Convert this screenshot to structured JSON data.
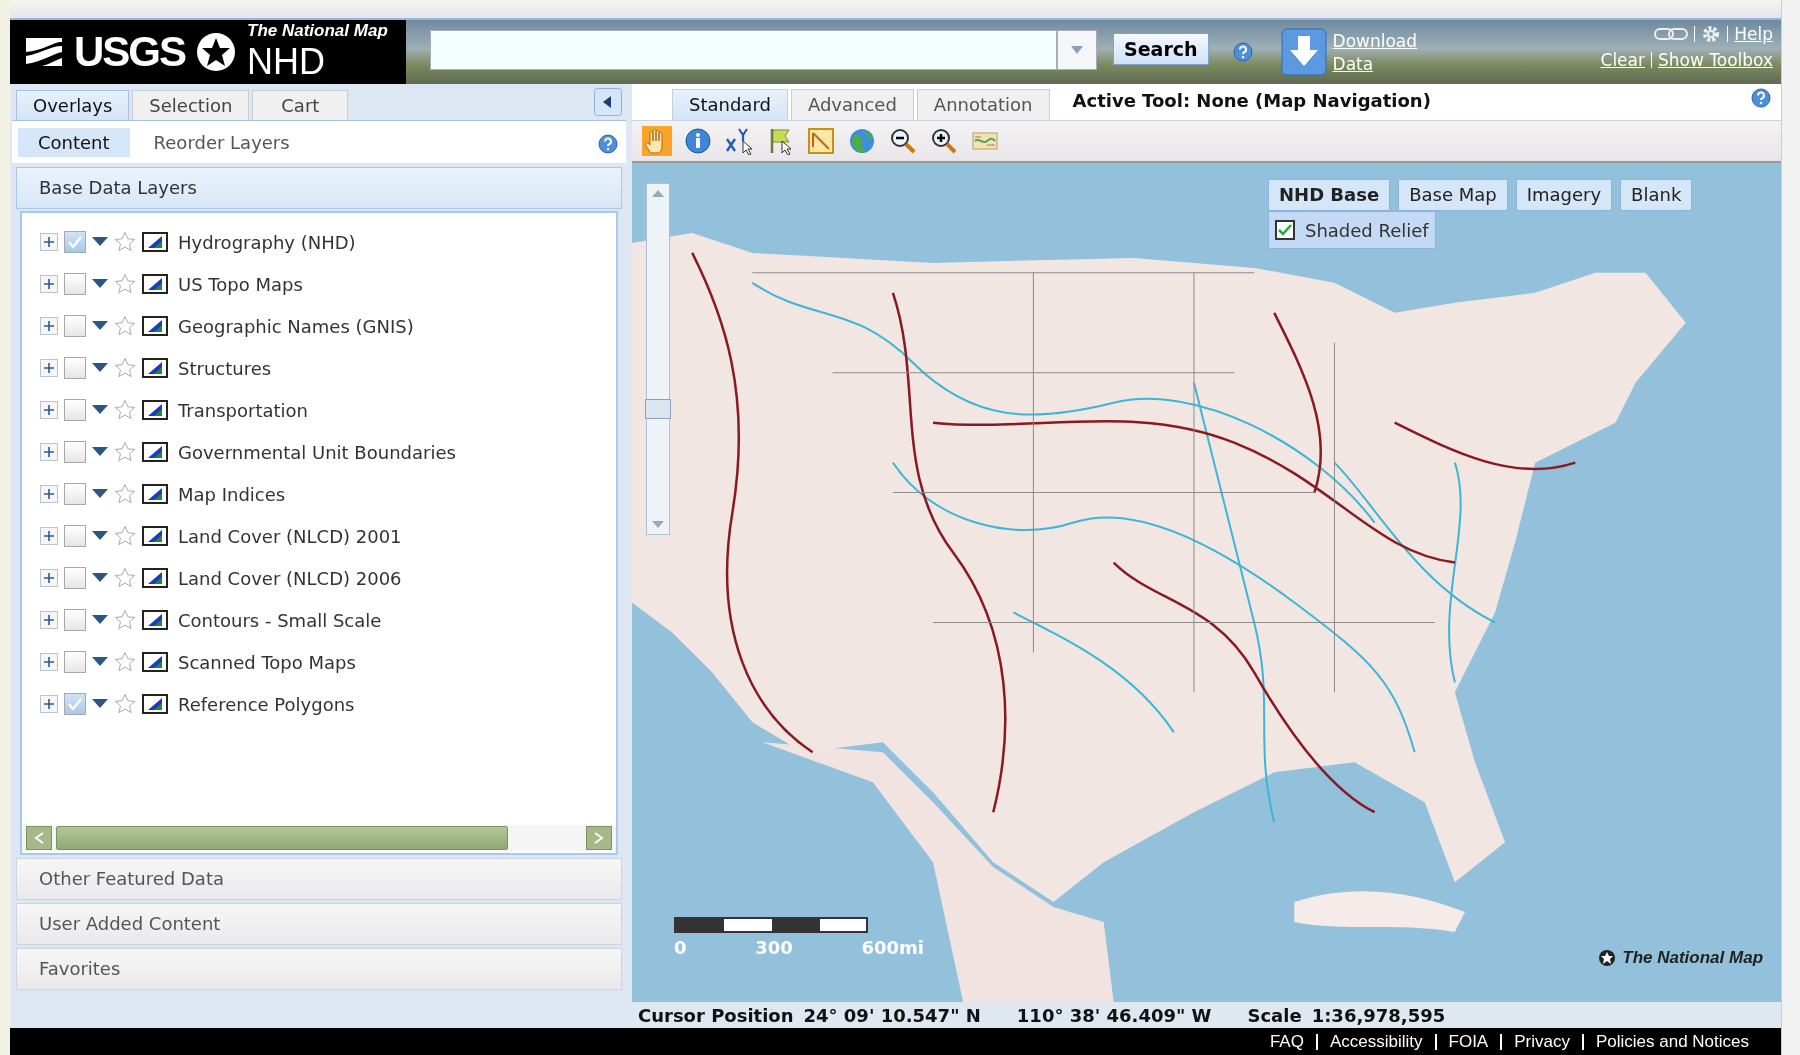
{
  "header": {
    "agency": "USGS",
    "product_title": "The National Map",
    "product_name": "NHD",
    "search_button": "Search",
    "download_link": "Download Data",
    "top_links": [
      "Help"
    ],
    "tool_links": [
      "Clear",
      "Show Toolbox"
    ]
  },
  "left_panel": {
    "tabs": [
      {
        "label": "Overlays",
        "selected": true
      },
      {
        "label": "Selection",
        "selected": false
      },
      {
        "label": "Cart",
        "selected": false
      }
    ],
    "subtabs": [
      {
        "label": "Content",
        "selected": true
      },
      {
        "label": "Reorder Layers",
        "selected": false
      }
    ],
    "section_title": "Base Data Layers",
    "layers": [
      {
        "name": "Hydrography (NHD)",
        "checked": true
      },
      {
        "name": "US Topo Maps",
        "checked": false
      },
      {
        "name": "Geographic Names (GNIS)",
        "checked": false
      },
      {
        "name": "Structures",
        "checked": false
      },
      {
        "name": "Transportation",
        "checked": false
      },
      {
        "name": "Governmental Unit Boundaries",
        "checked": false
      },
      {
        "name": "Map Indices",
        "checked": false
      },
      {
        "name": "Land Cover (NLCD) 2001",
        "checked": false
      },
      {
        "name": "Land Cover (NLCD) 2006",
        "checked": false
      },
      {
        "name": "Contours - Small Scale",
        "checked": false
      },
      {
        "name": "Scanned Topo Maps",
        "checked": false
      },
      {
        "name": "Reference Polygons",
        "checked": true
      }
    ],
    "accordion": [
      "Other Featured Data",
      "User Added Content",
      "Favorites"
    ]
  },
  "map_panel": {
    "tabs": [
      {
        "label": "Standard",
        "selected": true
      },
      {
        "label": "Advanced",
        "selected": false
      },
      {
        "label": "Annotation",
        "selected": false
      }
    ],
    "active_tool": "Active Tool: None (Map Navigation)",
    "tools": [
      {
        "kind": "pan",
        "selected": true
      },
      {
        "kind": "info",
        "selected": false
      },
      {
        "kind": "xy",
        "selected": false
      },
      {
        "kind": "flag",
        "selected": false
      },
      {
        "kind": "draw",
        "selected": false
      },
      {
        "kind": "globe",
        "selected": false
      },
      {
        "kind": "zoom-out",
        "selected": false
      },
      {
        "kind": "zoom-in",
        "selected": false
      },
      {
        "kind": "map",
        "selected": false
      }
    ],
    "basemaps": [
      {
        "label": "NHD Base",
        "selected": true
      },
      {
        "label": "Base Map",
        "selected": false
      },
      {
        "label": "Imagery",
        "selected": false
      },
      {
        "label": "Blank",
        "selected": false
      }
    ],
    "shaded_relief": {
      "label": "Shaded Relief",
      "checked": true
    },
    "zoom": {
      "level": 0.35
    },
    "scale_labels": [
      "0",
      "300",
      "600mi"
    ],
    "map_credit": "The National Map",
    "status": {
      "cursor_label": "Cursor Position",
      "latitude": "24° 09' 10.547\" N",
      "longitude": "110° 38' 46.409\" W",
      "scale_label": "Scale",
      "scale": "1:36,978,595"
    }
  },
  "footer_links": [
    "FAQ",
    "Accessibility",
    "FOIA",
    "Privacy",
    "Policies and Notices"
  ]
}
